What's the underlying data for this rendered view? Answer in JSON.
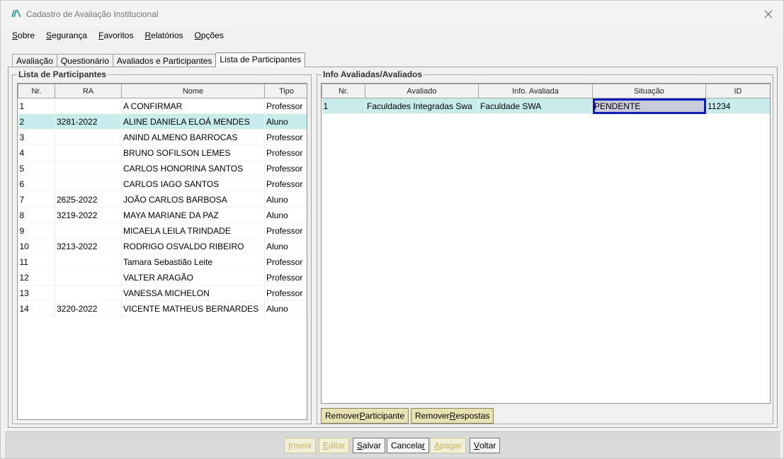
{
  "window": {
    "title": "Cadastro de Avaliação Institucional"
  },
  "menu": [
    {
      "pre": "",
      "u": "S",
      "post": "obre"
    },
    {
      "pre": "",
      "u": "S",
      "post": "egurança"
    },
    {
      "pre": "",
      "u": "F",
      "post": "avoritos"
    },
    {
      "pre": "",
      "u": "R",
      "post": "elatórios"
    },
    {
      "pre": "",
      "u": "O",
      "post": "pções"
    }
  ],
  "tabs": [
    "Avaliação",
    "Questionário",
    "Avaliados e Participantes",
    "Lista de Participantes"
  ],
  "participants": {
    "legend": "Lista de Participantes",
    "columns": [
      "Nr.",
      "RA",
      "Nome",
      "Tipo"
    ],
    "rows": [
      [
        "1",
        "",
        "A CONFIRMAR",
        "Professor"
      ],
      [
        "2",
        "3281-2022",
        "ALINE DANIELA ELOÁ MENDES",
        "Aluno"
      ],
      [
        "3",
        "",
        "ANIND ALMENO BARROCAS",
        "Professor"
      ],
      [
        "4",
        "",
        "BRUNO SOFILSON LEMES",
        "Professor"
      ],
      [
        "5",
        "",
        "CARLOS HONORINA SANTOS",
        "Professor"
      ],
      [
        "6",
        "",
        "CARLOS IAGO SANTOS",
        "Professor"
      ],
      [
        "7",
        "2625-2022",
        "JOÃO CARLOS BARBOSA",
        "Aluno"
      ],
      [
        "8",
        "3219-2022",
        "MAYA MARIANE DA PAZ",
        "Aluno"
      ],
      [
        "9",
        "",
        "MICAELA LEILA TRINDADE",
        "Professor"
      ],
      [
        "10",
        "3213-2022",
        "RODRIGO OSVALDO RIBEIRO",
        "Aluno"
      ],
      [
        "11",
        "",
        "Tamara Sebastião Leite",
        "Professor"
      ],
      [
        "12",
        "",
        "VALTER ARAGÃO",
        "Professor"
      ],
      [
        "13",
        "",
        "VANESSA MICHELON",
        "Professor"
      ],
      [
        "14",
        "3220-2022",
        "VICENTE MATHEUS BERNARDES",
        "Aluno"
      ]
    ]
  },
  "evaluated": {
    "legend": "Info Avaliadas/Avaliados",
    "columns": [
      "Nr.",
      "Avaliado",
      "Info. Avaliada",
      "Situação",
      "ID"
    ],
    "rows": [
      [
        "1",
        "Faculdades Integradas Swa",
        "Faculdade SWA",
        "PENDENTE",
        "11234"
      ]
    ]
  },
  "group_buttons": [
    {
      "pre": "Remover ",
      "u": "P",
      "post": "articipante"
    },
    {
      "pre": "Remover ",
      "u": "R",
      "post": "espostas"
    }
  ],
  "footer_buttons": [
    {
      "pre": "",
      "u": "I",
      "post": "nserir"
    },
    {
      "pre": "",
      "u": "E",
      "post": "ditar"
    },
    {
      "pre": "",
      "u": "S",
      "post": "alvar"
    },
    {
      "pre": "Cancela",
      "u": "r",
      "post": ""
    },
    {
      "pre": "",
      "u": "A",
      "post": "pagar"
    },
    {
      "pre": "",
      "u": "V",
      "post": "oltar"
    }
  ],
  "colors": {
    "selected_row": "#c8ebeb",
    "focus_border": "#0b1fb8",
    "logo": "#1a8f82"
  }
}
